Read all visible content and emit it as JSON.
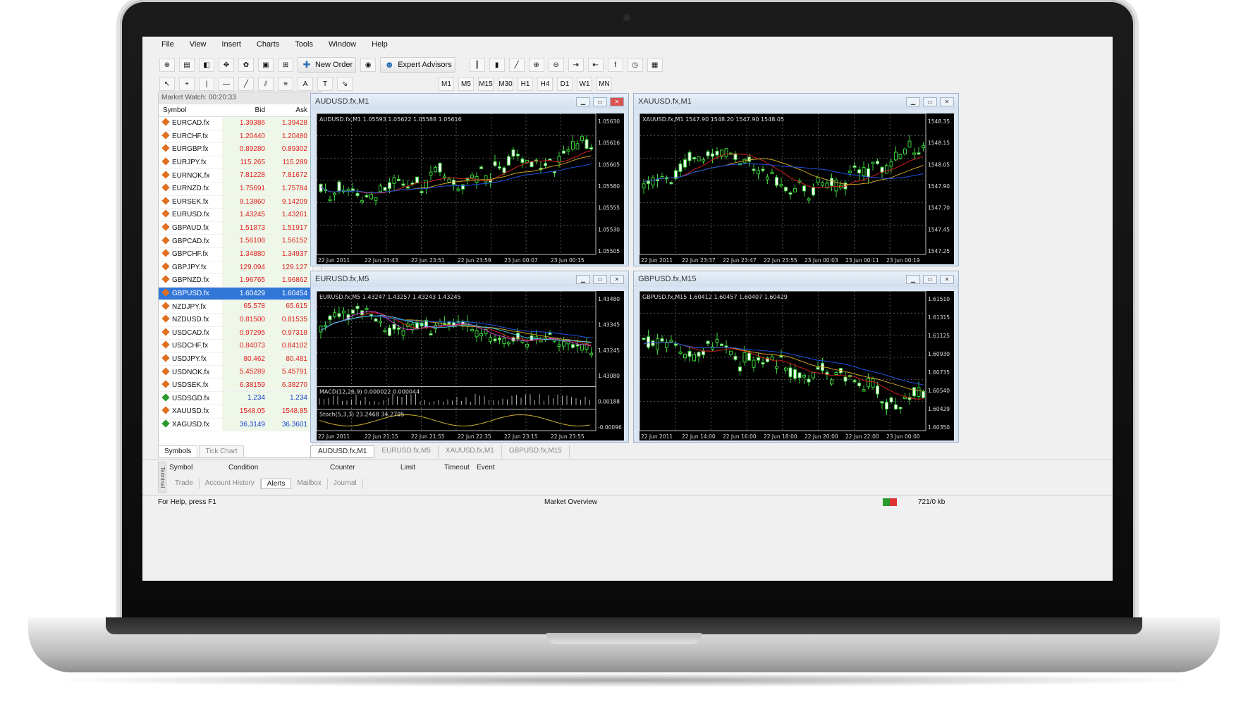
{
  "menu": [
    "File",
    "View",
    "Insert",
    "Charts",
    "Tools",
    "Window",
    "Help"
  ],
  "toolbar": {
    "new_order": "New Order",
    "expert_advisors": "Expert Advisors"
  },
  "timeframes": [
    "M1",
    "M5",
    "M15",
    "M30",
    "H1",
    "H4",
    "D1",
    "W1",
    "MN"
  ],
  "market_watch": {
    "title": "Market Watch: 00:20:33",
    "headers": {
      "symbol": "Symbol",
      "bid": "Bid",
      "ask": "Ask"
    },
    "rows": [
      {
        "symbol": "EURCAD.fx",
        "bid": "1.39386",
        "ask": "1.39428",
        "color": "red"
      },
      {
        "symbol": "EURCHF.fx",
        "bid": "1.20440",
        "ask": "1.20480",
        "color": "red"
      },
      {
        "symbol": "EURGBP.fx",
        "bid": "0.89280",
        "ask": "0.89302",
        "color": "red"
      },
      {
        "symbol": "EURJPY.fx",
        "bid": "115.265",
        "ask": "115.289",
        "color": "red"
      },
      {
        "symbol": "EURNOK.fx",
        "bid": "7.81228",
        "ask": "7.81672",
        "color": "red"
      },
      {
        "symbol": "EURNZD.fx",
        "bid": "1.75691",
        "ask": "1.75784",
        "color": "red"
      },
      {
        "symbol": "EURSEK.fx",
        "bid": "9.13860",
        "ask": "9.14209",
        "color": "red"
      },
      {
        "symbol": "EURUSD.fx",
        "bid": "1.43245",
        "ask": "1.43261",
        "color": "red"
      },
      {
        "symbol": "GBPAUD.fx",
        "bid": "1.51873",
        "ask": "1.51917",
        "color": "red"
      },
      {
        "symbol": "GBPCAD.fx",
        "bid": "1.56108",
        "ask": "1.56152",
        "color": "red"
      },
      {
        "symbol": "GBPCHF.fx",
        "bid": "1.34880",
        "ask": "1.34937",
        "color": "red"
      },
      {
        "symbol": "GBPJPY.fx",
        "bid": "129.094",
        "ask": "129.127",
        "color": "red"
      },
      {
        "symbol": "GBPNZD.fx",
        "bid": "1.96765",
        "ask": "1.96862",
        "color": "red"
      },
      {
        "symbol": "GBPUSD.fx",
        "bid": "1.60429",
        "ask": "1.60454",
        "color": "sel"
      },
      {
        "symbol": "NZDJPY.fx",
        "bid": "65.578",
        "ask": "65.615",
        "color": "red"
      },
      {
        "symbol": "NZDUSD.fx",
        "bid": "0.81500",
        "ask": "0.81535",
        "color": "red"
      },
      {
        "symbol": "USDCAD.fx",
        "bid": "0.97295",
        "ask": "0.97318",
        "color": "red"
      },
      {
        "symbol": "USDCHF.fx",
        "bid": "0.84073",
        "ask": "0.84102",
        "color": "red"
      },
      {
        "symbol": "USDJPY.fx",
        "bid": "80.462",
        "ask": "80.481",
        "color": "red"
      },
      {
        "symbol": "USDNOK.fx",
        "bid": "5.45289",
        "ask": "5.45791",
        "color": "red"
      },
      {
        "symbol": "USDSEK.fx",
        "bid": "6.38159",
        "ask": "6.38270",
        "color": "red"
      },
      {
        "symbol": "USDSGD.fx",
        "bid": "1.234",
        "ask": "1.234",
        "color": "blue"
      },
      {
        "symbol": "XAUUSD.fx",
        "bid": "1548.05",
        "ask": "1548.85",
        "color": "red"
      },
      {
        "symbol": "XAGUSD.fx",
        "bid": "36.3149",
        "ask": "36.3601",
        "color": "blue"
      }
    ],
    "tabs": [
      "Symbols",
      "Tick Chart"
    ]
  },
  "charts": [
    {
      "title": "AUDUSD.fx,M1",
      "info": "AUDUSD.fx,M1  1.05593 1.05622 1.05588 1.05616",
      "prices": [
        "1.05630",
        "1.05616",
        "1.05605",
        "1.05580",
        "1.05555",
        "1.05530",
        "1.05505"
      ],
      "times": [
        "22 Jun 2011",
        "22 Jun 23:43",
        "22 Jun 23:51",
        "22 Jun 23:59",
        "23 Jun 00:07",
        "23 Jun 00:15"
      ]
    },
    {
      "title": "XAUUSD.fx,M1",
      "info": "XAUUSD.fx,M1  1547.90 1548.20 1547.90 1548.05",
      "prices": [
        "1548.35",
        "1548.15",
        "1548.05",
        "1547.90",
        "1547.70",
        "1547.45",
        "1547.25"
      ],
      "times": [
        "22 Jun 2011",
        "22 Jun 23:37",
        "22 Jun 23:47",
        "22 Jun 23:55",
        "23 Jun 00:03",
        "23 Jun 00:11",
        "23 Jun 00:19"
      ]
    },
    {
      "title": "EURUSD.fx,M5",
      "info": "EURUSD.fx,M5  1.43247 1.43257 1.43243 1.43245",
      "prices": [
        "1.43480",
        "1.43345",
        "1.43245",
        "1.43080",
        "0.00188",
        "-0.00096"
      ],
      "macd": "MACD(12,26,9) 0.000022 0.000044",
      "stoch": "Stoch(5,3,3) 23.2468 34.2795",
      "times": [
        "22 Jun 2011",
        "22 Jun 21:15",
        "22 Jun 21:55",
        "22 Jun 22:35",
        "22 Jun 23:15",
        "22 Jun 23:55"
      ]
    },
    {
      "title": "GBPUSD.fx,M15",
      "info": "GBPUSD.fx,M15  1.60412 1.60457 1.60407 1.60429",
      "prices": [
        "1.61510",
        "1.61315",
        "1.61125",
        "1.60930",
        "1.60735",
        "1.60540",
        "1.60429",
        "1.60350"
      ],
      "times": [
        "22 Jun 2011",
        "22 Jun 14:00",
        "22 Jun 16:00",
        "22 Jun 18:00",
        "22 Jun 20:00",
        "22 Jun 22:00",
        "23 Jun 00:00"
      ]
    }
  ],
  "chart_tabs": [
    "AUDUSD.fx,M1",
    "EURUSD.fx,M5",
    "XAUUSD.fx,M1",
    "GBPUSD.fx,M15"
  ],
  "terminal": {
    "side_label": "Terminal",
    "headers": [
      "Symbol",
      "Condition",
      "Counter",
      "Limit",
      "Timeout",
      "Event"
    ],
    "tabs": [
      "Trade",
      "Account History",
      "Alerts",
      "Mailbox",
      "Journal"
    ]
  },
  "status": {
    "help": "For Help, press F1",
    "profile": "Market Overview",
    "traffic": "721/0 kb"
  }
}
